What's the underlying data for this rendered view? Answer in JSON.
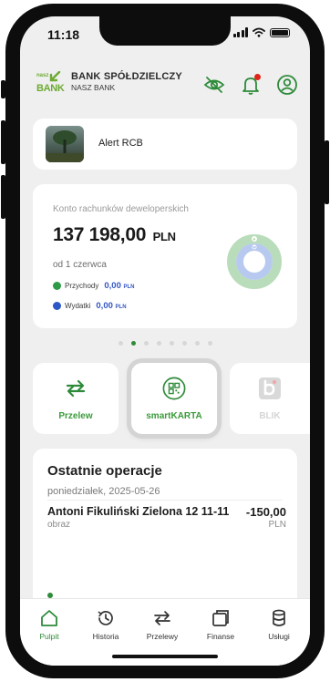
{
  "status": {
    "time": "11:18"
  },
  "brand": {
    "line1": "BANK SPÓŁDZIELCZY",
    "line2": "NASZ BANK",
    "mark_top": "nasz",
    "mark_bottom": "BANK",
    "color": "#6dab34"
  },
  "header_icons": [
    "eye-off-icon",
    "bell-icon",
    "user-icon"
  ],
  "alert": {
    "label": "Alert RCB"
  },
  "account": {
    "title": "Konto rachunków deweloperskich",
    "amount": "137 198,00",
    "currency": "PLN",
    "since": "od 1 czerwca",
    "income": {
      "label": "Przychody",
      "value": "0,00",
      "currency": "PLN",
      "color": "#2e9b46"
    },
    "expense": {
      "label": "Wydatki",
      "value": "0,00",
      "currency": "PLN",
      "color": "#2d56c8"
    },
    "donut": {
      "outer_color": "#b9dcba",
      "inner_color": "#b7c9ef",
      "marker_top": "P",
      "marker_inner": "W"
    }
  },
  "carousel": {
    "pages": 8,
    "active_index": 1
  },
  "tiles": [
    {
      "label": "Przelew",
      "icon": "transfer-icon",
      "enabled": true
    },
    {
      "label": "smartKARTA",
      "icon": "qr-code-icon",
      "enabled": true
    },
    {
      "label": "BLIK",
      "icon": "blik-icon",
      "enabled": false
    }
  ],
  "operations": {
    "title": "Ostatnie operacje",
    "date": "poniedziałek, 2025-05-26",
    "items": [
      {
        "name": "Antoni Fikuliński  Zielona 12 11-11",
        "sub": "obraz",
        "amount": "-150,00",
        "currency": "PLN"
      }
    ]
  },
  "tabbar": {
    "items": [
      {
        "label": "Pulpit",
        "icon": "home-icon",
        "active": true
      },
      {
        "label": "Historia",
        "icon": "history-icon",
        "active": false
      },
      {
        "label": "Przelewy",
        "icon": "transfers-icon",
        "active": false
      },
      {
        "label": "Finanse",
        "icon": "finance-icon",
        "active": false
      },
      {
        "label": "Usługi",
        "icon": "services-icon",
        "active": false
      }
    ]
  },
  "colors": {
    "accent": "#2e8b3a",
    "amount_blue": "#3355c5",
    "alert_dot": "#e0241b"
  }
}
